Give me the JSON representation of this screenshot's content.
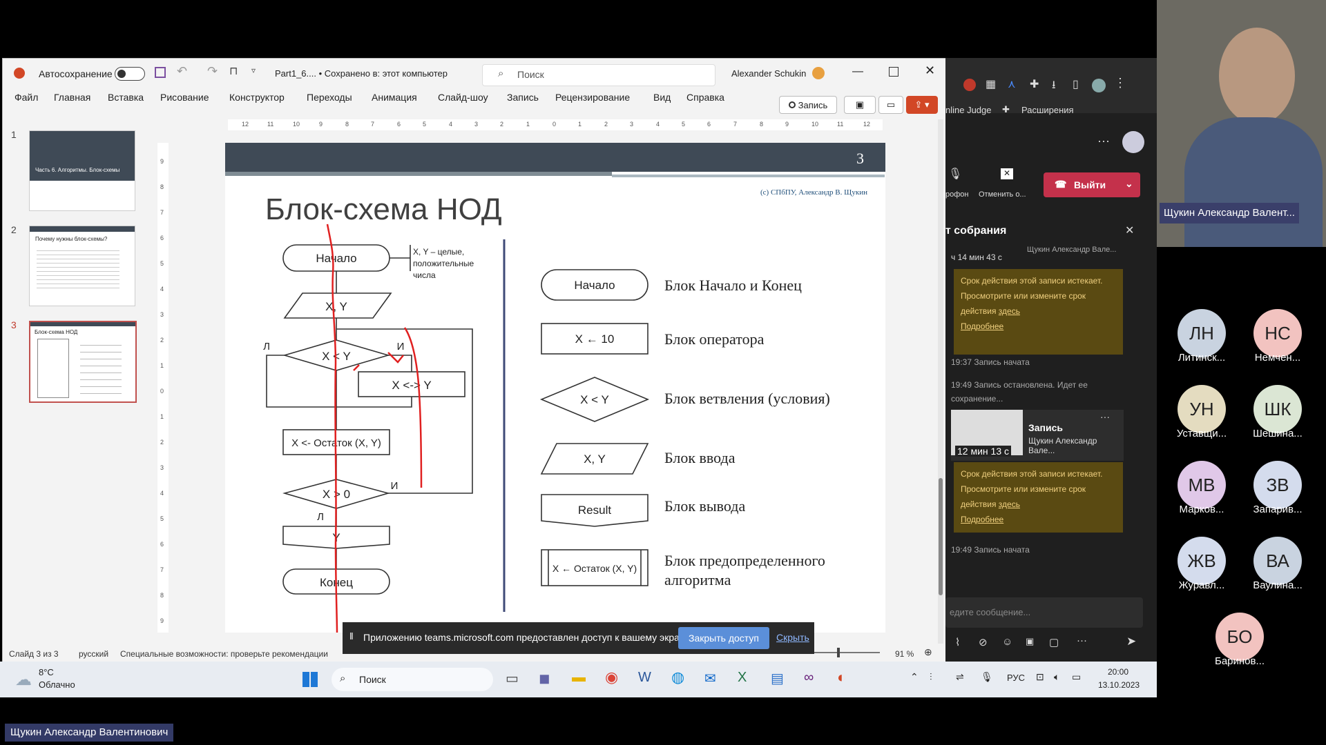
{
  "ppt": {
    "autosave_label": "Автосохранение",
    "file_title": "Part1_6.... • Сохранено в: этот компьютер",
    "search_placeholder": "Поиск",
    "user": "Alexander Schukin",
    "menu": [
      "Файл",
      "Главная",
      "Вставка",
      "Рисование",
      "Конструктор",
      "Переходы",
      "Анимация",
      "Слайд-шоу",
      "Запись",
      "Рецензирование",
      "Вид",
      "Справка"
    ],
    "record_button": "Запись",
    "thumbnails": [
      {
        "num": "1",
        "title": "Часть 6. Алгоритмы. Блок-схемы"
      },
      {
        "num": "2",
        "title": "Почему нужны блок-схемы?"
      },
      {
        "num": "3",
        "title": "Блок-схема НОД"
      }
    ],
    "hruler": [
      "12",
      "11",
      "10",
      "9",
      "8",
      "7",
      "6",
      "5",
      "4",
      "3",
      "2",
      "1",
      "0",
      "1",
      "2",
      "3",
      "4",
      "5",
      "6",
      "7",
      "8",
      "9",
      "10",
      "11",
      "12"
    ],
    "vruler": [
      "9",
      "8",
      "7",
      "6",
      "5",
      "4",
      "3",
      "2",
      "1",
      "0",
      "1",
      "2",
      "3",
      "4",
      "5",
      "6",
      "7",
      "8",
      "9"
    ],
    "status": {
      "slide": "Слайд 3 из 3",
      "lang": "русский",
      "access": "Специальные возможности: проверьте рекомендации",
      "zoom": "91 %"
    }
  },
  "slide": {
    "number": "3",
    "credit": "(c) СПбПУ, Александр В. Щукин",
    "title": "Блок-схема НОД",
    "flow": {
      "start": "Начало",
      "comment": "X, Y – целые, положительные числа",
      "input": "X, Y",
      "cond1": "X < Y",
      "no1": "Л",
      "yes1": "И",
      "swap": "X <-> Y",
      "op": "X <- Остаток (X, Y)",
      "cond2": "X > 0",
      "yes2": "И",
      "no2": "Л",
      "output": "Y",
      "end": "Конец"
    },
    "legend": [
      {
        "shape": "Начало",
        "label": "Блок Начало и Конец"
      },
      {
        "shape": "X ← 10",
        "label": "Блок оператора"
      },
      {
        "shape": "X < Y",
        "label": "Блок ветвления (условия)"
      },
      {
        "shape": "X, Y",
        "label": "Блок ввода"
      },
      {
        "shape": "Result",
        "label": "Блок вывода"
      },
      {
        "shape": "X ← Остаток (X, Y)",
        "label": "Блок предопределенного алгоритма"
      }
    ]
  },
  "share_bar": {
    "text": "Приложению teams.microsoft.com предоставлен доступ к вашему экрану.",
    "stop": "Закрыть доступ",
    "hide": "Скрыть"
  },
  "taskbar": {
    "weather_temp": "8°C",
    "weather_desc": "Облачно",
    "search": "Поиск",
    "lang": "РУС",
    "time": "20:00",
    "date": "13.10.2023"
  },
  "teams": {
    "bookmarks": [
      "nline Judge",
      "Расширения"
    ],
    "mic_label": "рофон",
    "cancel_label": "Отменить о...",
    "leave": "Выйти",
    "chat_title": "т собрания",
    "duration1": "ч 14 мин 43 с",
    "header_name": "Щукин Александр Вале...",
    "warning": "Срок действия этой записи истекает. Просмотрите или измените срок действия",
    "warning_link": "здесь",
    "more_link": "Подробнее",
    "event1": "19:37  Запись начата",
    "event2": "19:49  Запись остановлена. Идет ее сохранение...",
    "rec_title": "Запись",
    "rec_name": "Щукин Александр Вале...",
    "rec_duration": "12 мин 13 с",
    "event3": "19:49  Запись начата",
    "compose": "едите сообщение..."
  },
  "video_name": "Щукин Александр Валент...",
  "participants": [
    {
      "initials": "ЛН",
      "name": "Литинск...",
      "color": "#c9d3e0"
    },
    {
      "initials": "НС",
      "name": "Немчен...",
      "color": "#f2c3c0"
    },
    {
      "initials": "УН",
      "name": "Уставщи...",
      "color": "#e4dcc0"
    },
    {
      "initials": "ШК",
      "name": "Шешина...",
      "color": "#dbe6d4"
    },
    {
      "initials": "МВ",
      "name": "Марков...",
      "color": "#e0c8e8"
    },
    {
      "initials": "ЗВ",
      "name": "Запарив...",
      "color": "#d4dced"
    },
    {
      "initials": "ЖВ",
      "name": "Журавл...",
      "color": "#d4dced"
    },
    {
      "initials": "ВА",
      "name": "Ваулина...",
      "color": "#c9d3e0"
    },
    {
      "initials": "БО",
      "name": "Баринов...",
      "color": "#f2c3c0"
    }
  ],
  "bottom_name": "Щукин Александр Валентинович"
}
